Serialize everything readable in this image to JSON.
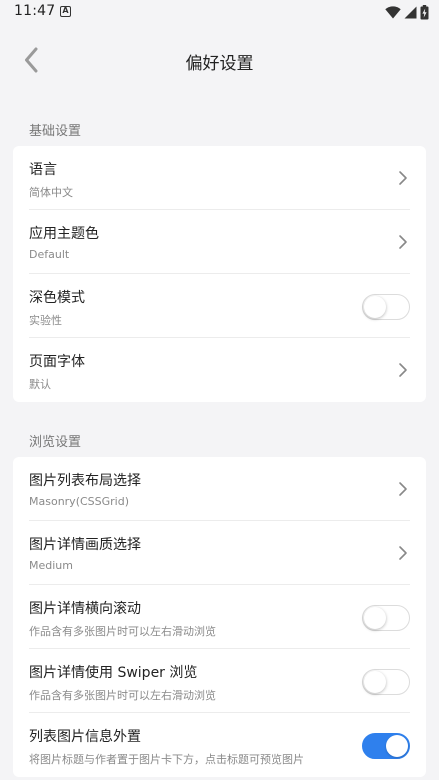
{
  "status_bar": {
    "time": "11:47",
    "notification_icon_letter": "A",
    "icons": [
      "wifi-icon",
      "signal-icon",
      "battery-charging-icon"
    ]
  },
  "header": {
    "title": "偏好设置",
    "back_icon": "chevron-left-icon"
  },
  "colors": {
    "accent": "#2f80ed",
    "background": "#f4f4f6",
    "card": "#ffffff"
  },
  "sections": [
    {
      "title": "基础设置",
      "items": [
        {
          "title": "语言",
          "subtitle": "简体中文",
          "control": "chevron"
        },
        {
          "title": "应用主题色",
          "subtitle": "Default",
          "control": "chevron"
        },
        {
          "title": "深色模式",
          "subtitle": "实验性",
          "control": "toggle",
          "enabled": false
        },
        {
          "title": "页面字体",
          "subtitle": "默认",
          "control": "chevron"
        }
      ]
    },
    {
      "title": "浏览设置",
      "items": [
        {
          "title": "图片列表布局选择",
          "subtitle": "Masonry(CSSGrid)",
          "control": "chevron"
        },
        {
          "title": "图片详情画质选择",
          "subtitle": "Medium",
          "control": "chevron"
        },
        {
          "title": "图片详情横向滚动",
          "subtitle": "作品含有多张图片时可以左右滑动浏览",
          "control": "toggle",
          "enabled": false
        },
        {
          "title": "图片详情使用 Swiper 浏览",
          "subtitle": "作品含有多张图片时可以左右滑动浏览",
          "control": "toggle",
          "enabled": false
        },
        {
          "title": "列表图片信息外置",
          "subtitle": "将图片标题与作者置于图片卡下方，点击标题可预览图片",
          "control": "toggle",
          "enabled": true
        }
      ]
    }
  ]
}
